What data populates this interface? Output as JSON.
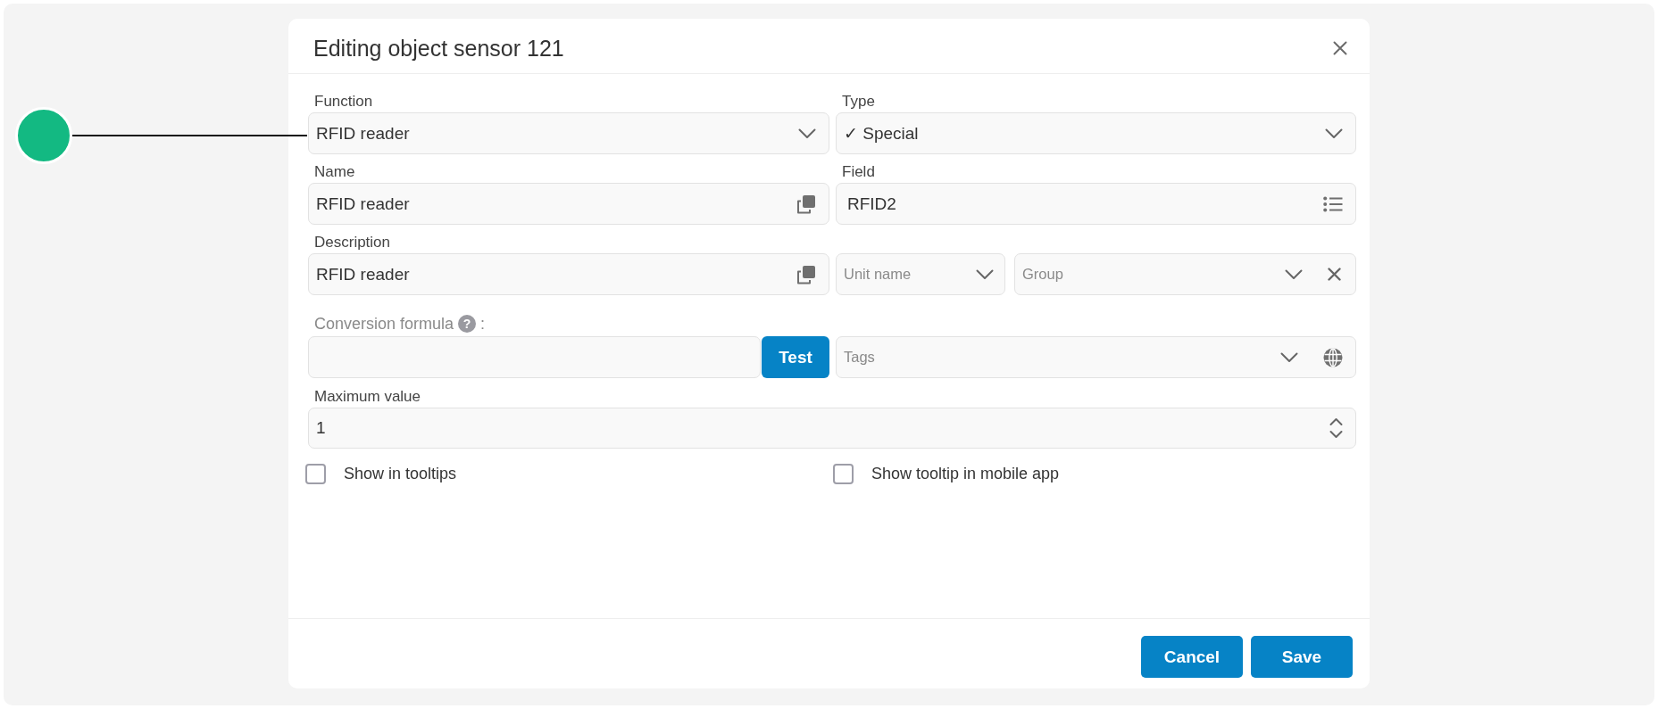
{
  "dialog": {
    "title": "Editing object sensor 121"
  },
  "function": {
    "label": "Function",
    "value": "RFID reader"
  },
  "type": {
    "label": "Type",
    "value": "✓ Special"
  },
  "name": {
    "label": "Name",
    "value": "RFID reader"
  },
  "field": {
    "label": "Field",
    "value": "RFID2"
  },
  "description": {
    "label": "Description",
    "value": "RFID reader"
  },
  "unit_name": {
    "placeholder": "Unit name"
  },
  "group": {
    "placeholder": "Group"
  },
  "conversion_formula": {
    "label": "Conversion formula",
    "help": "?",
    "suffix": ":",
    "button": "Test"
  },
  "tags": {
    "placeholder": "Tags"
  },
  "maximum_value": {
    "label": "Maximum value",
    "value": "1"
  },
  "checkboxes": [
    {
      "label": "Show in tooltips",
      "checked": false
    },
    {
      "label": "Show tooltip in mobile app",
      "checked": false
    }
  ],
  "footer": {
    "buttons": [
      "Cancel",
      "Save"
    ]
  }
}
